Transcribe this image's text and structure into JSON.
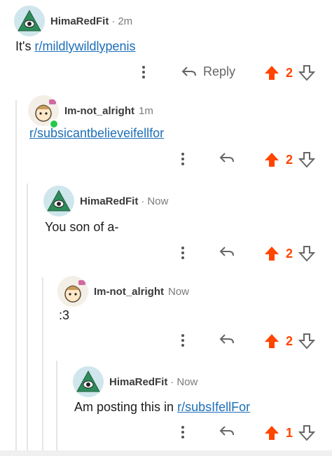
{
  "comments": [
    {
      "user": "HimaRedFit",
      "sep": "·",
      "time": "2m",
      "text_prefix": "It's ",
      "link": "r/mildlywildlypenis",
      "text_suffix": "",
      "reply_label": "Reply",
      "votes": "2"
    },
    {
      "user": "Im-not_alright",
      "sep": "",
      "time": "1m",
      "text_prefix": "",
      "link": "r/subsicantbelieveifellfor",
      "text_suffix": "",
      "reply_label": "",
      "votes": "2"
    },
    {
      "user": "HimaRedFit",
      "sep": "·",
      "time": "Now",
      "text_prefix": "You son of a-",
      "link": "",
      "text_suffix": "",
      "reply_label": "",
      "votes": "2"
    },
    {
      "user": "Im-not_alright",
      "sep": "",
      "time": "Now",
      "text_prefix": ":3",
      "link": "",
      "text_suffix": "",
      "reply_label": "",
      "votes": "2"
    },
    {
      "user": "HimaRedFit",
      "sep": "·",
      "time": "Now",
      "text_prefix": "Am posting this in ",
      "link": "r/subsIfellFor",
      "text_suffix": "",
      "reply_label": "",
      "votes": "1"
    }
  ],
  "colors": {
    "upvote": "#ff4500",
    "link": "#1d6fb8",
    "thread": "#e5e5e5"
  },
  "icons": {
    "avatar_hima": "illuminati-eye-avatar",
    "avatar_im": "cat-girl-avatar",
    "more": "more-vertical-icon",
    "reply": "reply-arrow-icon",
    "upvote": "upvote-arrow-icon",
    "downvote": "downvote-arrow-icon"
  }
}
